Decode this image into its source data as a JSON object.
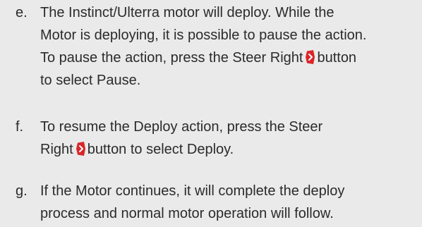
{
  "steps": [
    {
      "letter": "e.",
      "segments": [
        {
          "text": "The Instinct/Ulterra motor will deploy. While the"
        },
        {
          "text": "Motor is deploying, it is possible to pause the action."
        },
        {
          "text": "To pause the action, press the Steer Right",
          "after_icon": "button",
          "icon": "steer-right-icon"
        },
        {
          "text": "to select Pause."
        }
      ]
    },
    {
      "letter": "f.",
      "segments": [
        {
          "text": "To resume the Deploy action, press the Steer"
        },
        {
          "text": "Right",
          "after_icon": "button to select Deploy.",
          "icon": "steer-right-icon"
        }
      ]
    },
    {
      "letter": "g.",
      "segments": [
        {
          "text": "If the Motor continues, it will complete the deploy"
        },
        {
          "text": "process and normal motor operation will follow."
        }
      ]
    }
  ],
  "colors": {
    "background": "#eaeaea",
    "text": "#2b2b2b",
    "icon_red": "#d9262b",
    "icon_chevron": "#ffffff"
  }
}
